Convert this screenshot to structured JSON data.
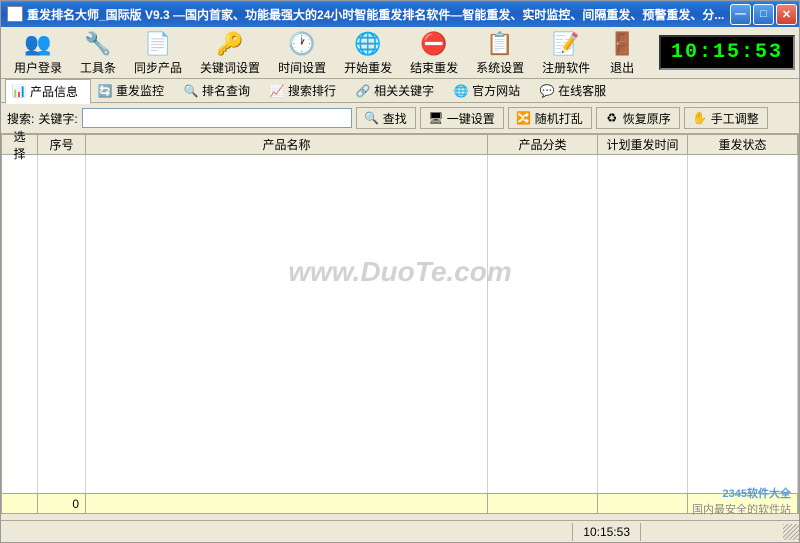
{
  "window": {
    "title": "重发排名大师_国际版 V9.3 —国内首家、功能最强大的24小时智能重发排名软件—智能重发、实时监控、间隔重发、预警重发、分..."
  },
  "clock": "10:15:53",
  "toolbar": [
    {
      "label": "用户登录",
      "icon": "👥"
    },
    {
      "label": "工具条",
      "icon": "🔧"
    },
    {
      "label": "同步产品",
      "icon": "📄"
    },
    {
      "label": "关键词设置",
      "icon": "🔑"
    },
    {
      "label": "时间设置",
      "icon": "🕐"
    },
    {
      "label": "开始重发",
      "icon": "🌐"
    },
    {
      "label": "结束重发",
      "icon": "⛔"
    },
    {
      "label": "系统设置",
      "icon": "📋"
    },
    {
      "label": "注册软件",
      "icon": "📝"
    },
    {
      "label": "退出",
      "icon": "🚪"
    }
  ],
  "tabs": [
    {
      "label": "产品信息",
      "icon": "📊",
      "active": true
    },
    {
      "label": "重发监控",
      "icon": "🔄",
      "active": false
    },
    {
      "label": "排名查询",
      "icon": "🔍",
      "active": false
    },
    {
      "label": "搜索排行",
      "icon": "📈",
      "active": false
    },
    {
      "label": "相关关键字",
      "icon": "🔗",
      "active": false
    },
    {
      "label": "官方网站",
      "icon": "🌐",
      "active": false
    },
    {
      "label": "在线客服",
      "icon": "💬",
      "active": false
    }
  ],
  "search": {
    "prefix": "搜索:",
    "keyword_label": "关键字:",
    "value": ""
  },
  "actions": [
    {
      "label": "查找",
      "icon": "🔍"
    },
    {
      "label": "一键设置",
      "icon": "🖥"
    },
    {
      "label": "随机打乱",
      "icon": "🔀"
    },
    {
      "label": "恢复原序",
      "icon": "♻"
    },
    {
      "label": "手工调整",
      "icon": "✋"
    }
  ],
  "columns": {
    "select": "选择",
    "seq": "序号",
    "name": "产品名称",
    "category": "产品分类",
    "plan_time": "计划重发时间",
    "status": "重发状态"
  },
  "footer_count": "0",
  "status_time": "10:15:53",
  "watermark": "www.DuoTe.com",
  "attribution": {
    "brand": "2345软件大全",
    "slogan": "国内最安全的软件站"
  }
}
